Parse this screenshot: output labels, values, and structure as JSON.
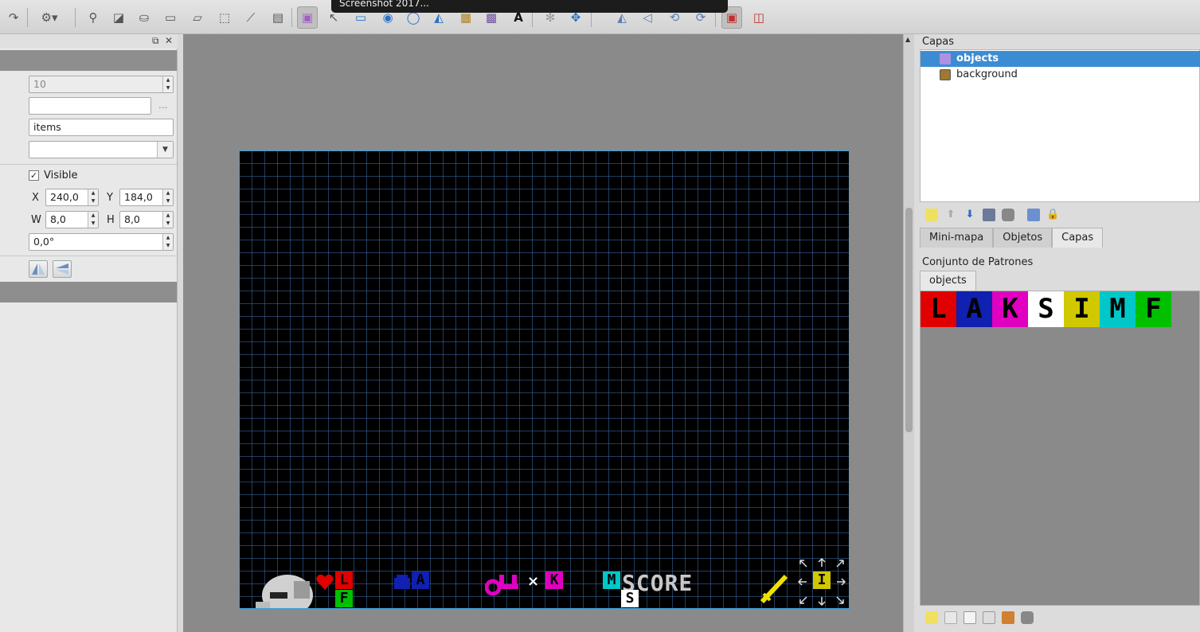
{
  "tooltip": {
    "text": "Screenshot 2017..."
  },
  "toolbar": {
    "icons": [
      "redo-icon",
      "settings-icon",
      "stamp-icon",
      "terrain-icon",
      "bucket-fill-icon",
      "rectangle-icon",
      "eraser-icon",
      "rect-select-icon",
      "magic-wand-icon",
      "select-same-icon",
      "select-objects-icon",
      "edit-polygons-icon",
      "insert-rectangle-icon",
      "insert-point-icon",
      "insert-ellipse-icon",
      "insert-polygon-icon",
      "insert-tile-icon",
      "insert-template-icon",
      "insert-text-icon",
      "gear-icon",
      "move-icon",
      "flip-horizontal-icon",
      "flip-vertical-icon",
      "rotate-left-icon",
      "rotate-right-icon",
      "highlight-layer-icon",
      "random-mode-icon"
    ]
  },
  "properties": {
    "id_value": "10",
    "name_value": "",
    "browse_label": "...",
    "type_value": "items",
    "template_value": "",
    "visible_label": "Visible",
    "visible_checked": true,
    "x_label": "X",
    "x_value": "240,0",
    "y_label": "Y",
    "y_value": "184,0",
    "w_label": "W",
    "w_value": "8,0",
    "h_label": "H",
    "h_value": "8,0",
    "rotation_value": "0,0°"
  },
  "map": {
    "score_text": "SCORE",
    "tiles": [
      {
        "letter": "L",
        "bg": "#e00000",
        "fg": "#000000"
      },
      {
        "letter": "F",
        "bg": "#00c000",
        "fg": "#000000"
      },
      {
        "letter": "A",
        "bg": "#1020b0",
        "fg": "#000000"
      },
      {
        "letter": "K",
        "bg": "#e000c0",
        "fg": "#000000"
      },
      {
        "letter": "M",
        "bg": "#00c8c8",
        "fg": "#000000"
      },
      {
        "letter": "S",
        "bg": "#ffffff",
        "fg": "#000000"
      },
      {
        "letter": "I",
        "bg": "#d0c800",
        "fg": "#000000"
      }
    ],
    "colors": {
      "grid": "#2a4a7a",
      "border": "#3aa0e0",
      "background": "#000000"
    }
  },
  "layers_panel": {
    "title": "Capas",
    "layers": [
      {
        "name": "objects",
        "selected": true,
        "icon": "object-layer-icon"
      },
      {
        "name": "background",
        "selected": false,
        "icon": "image-layer-icon"
      }
    ]
  },
  "dock_tabs": [
    "Mini-mapa",
    "Objetos",
    "Capas"
  ],
  "dock_active": "Capas",
  "tileset_panel": {
    "title": "Conjunto de Patrones",
    "tab": "objects",
    "tiles": [
      {
        "letter": "L",
        "bg": "#e00000"
      },
      {
        "letter": "A",
        "bg": "#1020b0"
      },
      {
        "letter": "K",
        "bg": "#e000c0"
      },
      {
        "letter": "S",
        "bg": "#ffffff"
      },
      {
        "letter": "I",
        "bg": "#d0c800"
      },
      {
        "letter": "M",
        "bg": "#00c8c8"
      },
      {
        "letter": "F",
        "bg": "#00c000"
      }
    ]
  },
  "accent_color": "#3c8cd4"
}
